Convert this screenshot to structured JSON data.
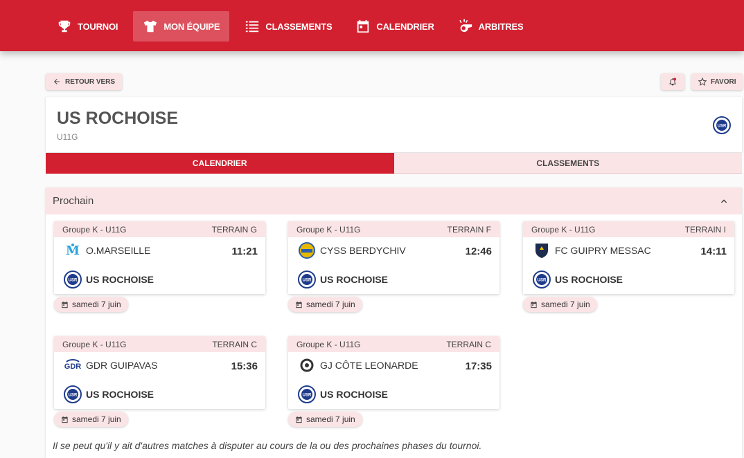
{
  "nav": {
    "items": [
      {
        "label": "TOURNOI",
        "icon": "trophy-icon"
      },
      {
        "label": "MON ÉQUIPE",
        "icon": "tshirt-icon",
        "active": true
      },
      {
        "label": "CLASSEMENTS",
        "icon": "list-icon"
      },
      {
        "label": "CALENDRIER",
        "icon": "calendar-icon"
      },
      {
        "label": "ARBITRES",
        "icon": "whistle-icon"
      }
    ]
  },
  "actions": {
    "back_label": "RETOUR VERS",
    "favorite_label": "FAVORI"
  },
  "team": {
    "name": "US ROCHOISE",
    "category": "U11G",
    "logo_text": "USR"
  },
  "tabs": [
    {
      "label": "CALENDRIER",
      "active": true
    },
    {
      "label": "CLASSEMENTS",
      "active": false
    }
  ],
  "section": {
    "title": "Prochain"
  },
  "matches": [
    {
      "group": "Groupe K - U11G",
      "field": "TERRAIN G",
      "home": "O.MARSEILLE",
      "away": "US ROCHOISE",
      "time": "11:21",
      "date": "samedi 7 juin",
      "home_logo": "om",
      "home_color": "#2aa3dc"
    },
    {
      "group": "Groupe K - U11G",
      "field": "TERRAIN F",
      "home": "CYSS BERDYCHIV",
      "away": "US ROCHOISE",
      "time": "12:46",
      "date": "samedi 7 juin",
      "home_logo": "cyss",
      "home_color": "#e6b800"
    },
    {
      "group": "Groupe K - U11G",
      "field": "TERRAIN I",
      "home": "FC GUIPRY MESSAC",
      "away": "US ROCHOISE",
      "time": "14:11",
      "date": "samedi 7 juin",
      "home_logo": "fcgm",
      "home_color": "#1d2b4f"
    },
    {
      "group": "Groupe K - U11G",
      "field": "TERRAIN C",
      "home": "GDR GUIPAVAS",
      "away": "US ROCHOISE",
      "time": "15:36",
      "date": "samedi 7 juin",
      "home_logo": "gdr",
      "home_color": "#1f3c8c"
    },
    {
      "group": "Groupe K - U11G",
      "field": "TERRAIN C",
      "home": "GJ CÔTE LEONARDE",
      "away": "US ROCHOISE",
      "time": "17:35",
      "date": "samedi 7 juin",
      "home_logo": "gjcl",
      "home_color": "#333333"
    }
  ],
  "footnote": "Il se peut qu'il y ait d'autres matches à disputer au cours de la ou des prochaines phases du tournoi.",
  "colors": {
    "primary": "#d22030",
    "tint": "#fbe4e6"
  }
}
